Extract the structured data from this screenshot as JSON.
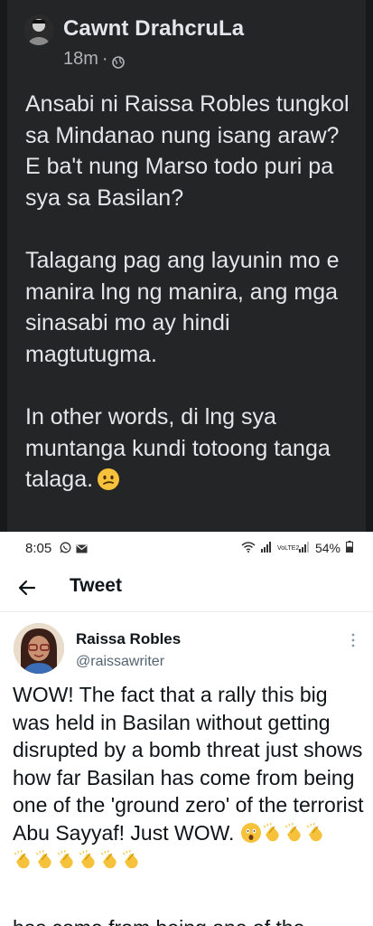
{
  "facebook_post": {
    "author": "Cawnt DrahcruLa",
    "time": "18m",
    "separator": "·",
    "paragraphs": [
      "Ansabi ni Raissa Robles tungkol sa Mindanao nung isang araw? E ba't nung Marso todo puri pa sya sa Basilan?",
      "Talagang pag ang layunin mo e manira lng ng manira, ang mga sinasabi mo ay hindi magtutugma.",
      "In other words, di lng sya muntanga kundi totoong tanga talaga."
    ],
    "end_emoji": "confused-face"
  },
  "status_bar": {
    "time": "8:05",
    "network": "VoLTE2",
    "battery": "54%"
  },
  "tweet_header": {
    "title": "Tweet"
  },
  "tweet": {
    "name": "Raissa Robles",
    "handle": "@raissawriter",
    "text": "WOW! The fact that a rally this big was held in Basilan without getting disrupted by a bomb threat just shows how far Basilan has come from being one of the 'ground zero' of the terrorist Abu Sayyaf! Just WOW.",
    "emojis_line1": [
      "astonished-face",
      "clapping-hands",
      "clapping-hands",
      "clapping-hands"
    ],
    "emojis_line2": [
      "clapping-hands",
      "clapping-hands",
      "clapping-hands",
      "clapping-hands",
      "clapping-hands",
      "clapping-hands"
    ],
    "cutoff_text": "has come from being one of the"
  }
}
